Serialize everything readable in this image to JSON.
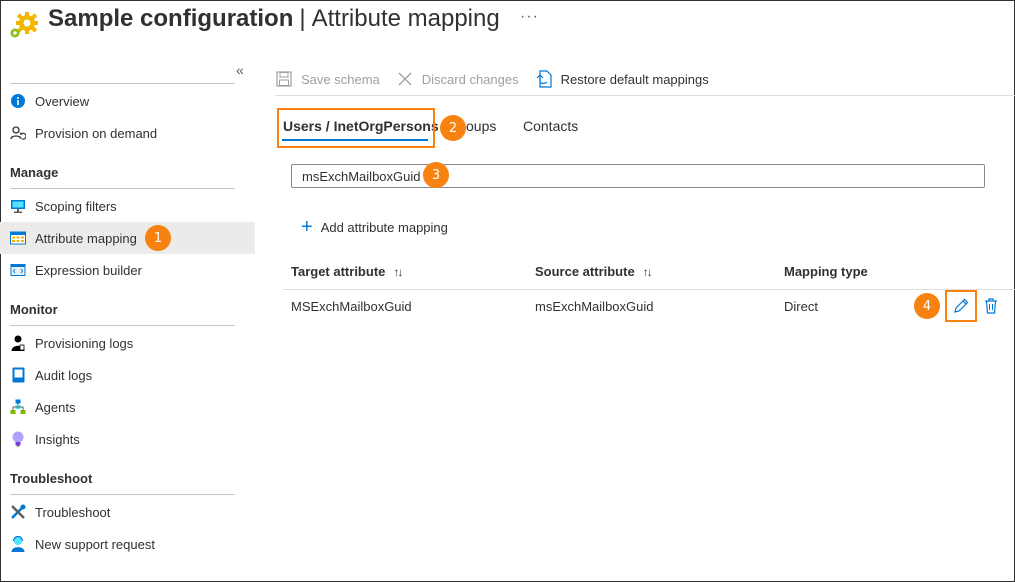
{
  "header": {
    "title": "Sample configuration",
    "separator": "|",
    "subtitle": "Attribute mapping",
    "more": "···"
  },
  "sidebar": {
    "collapse": "«",
    "items": [
      {
        "label": "Overview",
        "icon": "info-icon"
      },
      {
        "label": "Provision on demand",
        "icon": "person-sync-icon"
      }
    ],
    "sections": [
      {
        "title": "Manage",
        "items": [
          {
            "label": "Scoping filters",
            "icon": "monitor-icon"
          },
          {
            "label": "Attribute mapping",
            "icon": "table-icon",
            "active": true
          },
          {
            "label": "Expression builder",
            "icon": "code-window-icon"
          }
        ]
      },
      {
        "title": "Monitor",
        "items": [
          {
            "label": "Provisioning logs",
            "icon": "person-icon"
          },
          {
            "label": "Audit logs",
            "icon": "log-book-icon"
          },
          {
            "label": "Agents",
            "icon": "org-chart-icon"
          },
          {
            "label": "Insights",
            "icon": "lightbulb-icon"
          }
        ]
      },
      {
        "title": "Troubleshoot",
        "items": [
          {
            "label": "Troubleshoot",
            "icon": "tools-icon"
          },
          {
            "label": "New support request",
            "icon": "support-person-icon"
          }
        ]
      }
    ]
  },
  "toolbar": {
    "save": "Save schema",
    "discard": "Discard changes",
    "restore": "Restore default mappings"
  },
  "tabs": [
    {
      "label": "Users / InetOrgPersons",
      "active": true
    },
    {
      "label": "oups"
    },
    {
      "label": "Contacts"
    }
  ],
  "filter": {
    "value": "msExchMailboxGuid"
  },
  "add_mapping": "Add attribute mapping",
  "table": {
    "columns": [
      "Target attribute",
      "Source attribute",
      "Mapping type"
    ],
    "sort_glyph": "↑↓",
    "rows": [
      {
        "target": "MSExchMailboxGuid",
        "source": "msExchMailboxGuid",
        "type": "Direct"
      }
    ]
  },
  "badges": [
    "1",
    "2",
    "3",
    "4"
  ],
  "colors": {
    "accent": "#0078d4",
    "highlight": "#f7820f",
    "active_bg": "#edebe9"
  }
}
